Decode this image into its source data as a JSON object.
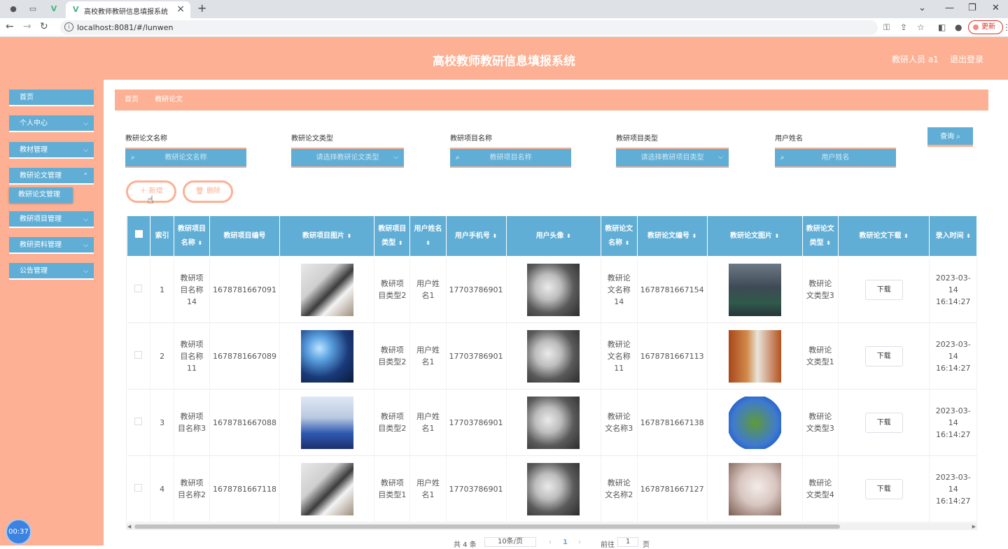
{
  "browser": {
    "tab_title": "高校教师教研信息填报系统",
    "url": "localhost:8081/#/lunwen",
    "update_label": "更新"
  },
  "header": {
    "title": "高校教师教研信息填报系统",
    "user": "教研人员 a1",
    "logout": "退出登录"
  },
  "sidebar": {
    "items": [
      {
        "label": "首页"
      },
      {
        "label": "个人中心"
      },
      {
        "label": "教材管理"
      },
      {
        "label": "教研论文管理"
      },
      {
        "label": "教研项目管理"
      },
      {
        "label": "教研资料管理"
      },
      {
        "label": "公告管理"
      }
    ],
    "submenu_active": "教研论文管理",
    "timer": "00:37"
  },
  "breadcrumb": {
    "home": "首页",
    "current": "教研论文"
  },
  "search": {
    "fields": [
      {
        "label": "教研论文名称",
        "placeholder": "教研论文名称"
      },
      {
        "label": "教研论文类型",
        "placeholder": "请选择教研论文类型"
      },
      {
        "label": "教研项目名称",
        "placeholder": "教研项目名称"
      },
      {
        "label": "教研项目类型",
        "placeholder": "请选择教研项目类型"
      },
      {
        "label": "用户姓名",
        "placeholder": "用户姓名"
      }
    ],
    "query_label": "查询",
    "add_label": "新增",
    "delete_label": "删除"
  },
  "table": {
    "headers": {
      "index": "索引",
      "project_name": "教研项目名称",
      "project_no": "教研项目编号",
      "project_image": "教研项目图片",
      "project_type": "教研项目类型",
      "user_name": "用户姓名",
      "user_phone": "用户手机号",
      "user_avatar": "用户头像",
      "paper_name": "教研论文名称",
      "paper_no": "教研论文编号",
      "paper_image": "教研论文图片",
      "paper_type": "教研论文类型",
      "paper_download": "教研论文下载",
      "entry_time": "录入时间"
    },
    "rows": [
      {
        "index": "1",
        "project_name": "教研项目名称14",
        "project_no": "1678781667091",
        "project_type": "教研项目类型2",
        "user_name": "用户姓名1",
        "user_phone": "17703786901",
        "paper_name": "教研论文名称14",
        "paper_no": "1678781667154",
        "paper_type": "教研论文类型3",
        "download": "下载",
        "entry_time": "2023-03-14 16:14:27"
      },
      {
        "index": "2",
        "project_name": "教研项目名称11",
        "project_no": "1678781667089",
        "project_type": "教研项目类型2",
        "user_name": "用户姓名1",
        "user_phone": "17703786901",
        "paper_name": "教研论文名称11",
        "paper_no": "1678781667113",
        "paper_type": "教研论文类型1",
        "download": "下载",
        "entry_time": "2023-03-14 16:14:27"
      },
      {
        "index": "3",
        "project_name": "教研项目名称3",
        "project_no": "1678781667088",
        "project_type": "教研项目类型2",
        "user_name": "用户姓名1",
        "user_phone": "17703786901",
        "paper_name": "教研论文名称3",
        "paper_no": "1678781667138",
        "paper_type": "教研论文类型3",
        "download": "下载",
        "entry_time": "2023-03-14 16:14:27"
      },
      {
        "index": "4",
        "project_name": "教研项目名称2",
        "project_no": "1678781667118",
        "project_type": "教研项目类型1",
        "user_name": "用户姓名1",
        "user_phone": "17703786901",
        "paper_name": "教研论文名称2",
        "paper_no": "1678781667127",
        "paper_type": "教研论文类型4",
        "download": "下载",
        "entry_time": "2023-03-14 16:14:27"
      }
    ]
  },
  "pagination": {
    "total": "共 4 条",
    "page_size": "10条/页",
    "current_page": "1",
    "goto": "前往",
    "goto_value": "1",
    "page_unit": "页"
  },
  "colors": {
    "accent": "#fdb093",
    "primary": "#60aed5"
  }
}
